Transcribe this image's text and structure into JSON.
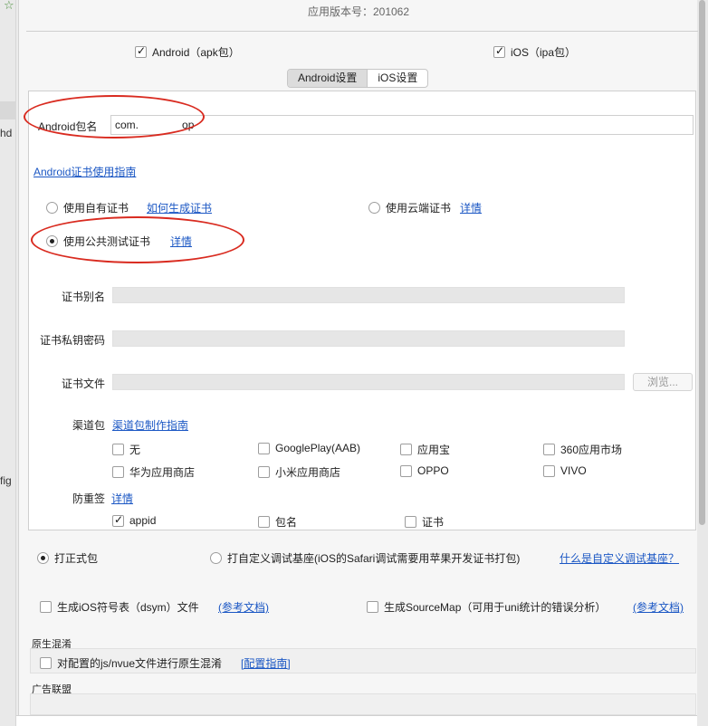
{
  "side": {
    "hd": "hd",
    "fig": "fig"
  },
  "version_text": "应用版本号：201062",
  "platforms": {
    "android": "Android（apk包）",
    "ios": "iOS（ipa包）"
  },
  "tabs": [
    "Android设置",
    "iOS设置"
  ],
  "android": {
    "package_label": "Android包名",
    "package_value": "com.",
    "package_value_end": "op",
    "guide_link": "Android证书使用指南",
    "cert_own": "使用自有证书",
    "cert_own_link": "如何生成证书",
    "cert_cloud": "使用云端证书",
    "cert_cloud_link": "详情",
    "cert_public": "使用公共测试证书",
    "cert_public_link": "详情",
    "alias_label": "证书别名",
    "key_label": "证书私钥密码",
    "file_label": "证书文件",
    "browse_button": "浏览...",
    "channel_label": "渠道包",
    "channel_link": "渠道包制作指南",
    "channels": [
      "无",
      "GooglePlay(AAB)",
      "应用宝",
      "360应用市场",
      "华为应用商店",
      "小米应用商店",
      "OPPO",
      "VIVO"
    ],
    "anti_label": "防重签",
    "anti_link": "详情",
    "anti_options": [
      "appid",
      "包名",
      "证书"
    ]
  },
  "pack": {
    "formal": "打正式包",
    "custom": "打自定义调试基座(iOS的Safari调试需要用苹果开发证书打包)",
    "custom_link": "什么是自定义调试基座？"
  },
  "options": {
    "dsym": "生成iOS符号表（dsym）文件",
    "dsym_link": "(参考文档)",
    "sourcemap": "生成SourceMap（可用于uni统计的错误分析）",
    "sourcemap_link": "(参考文档)"
  },
  "obfuscate": {
    "title": "原生混淆",
    "label": "对配置的js/nvue文件进行原生混淆",
    "link": "[配置指南]"
  },
  "ads": {
    "title": "广告联盟"
  }
}
